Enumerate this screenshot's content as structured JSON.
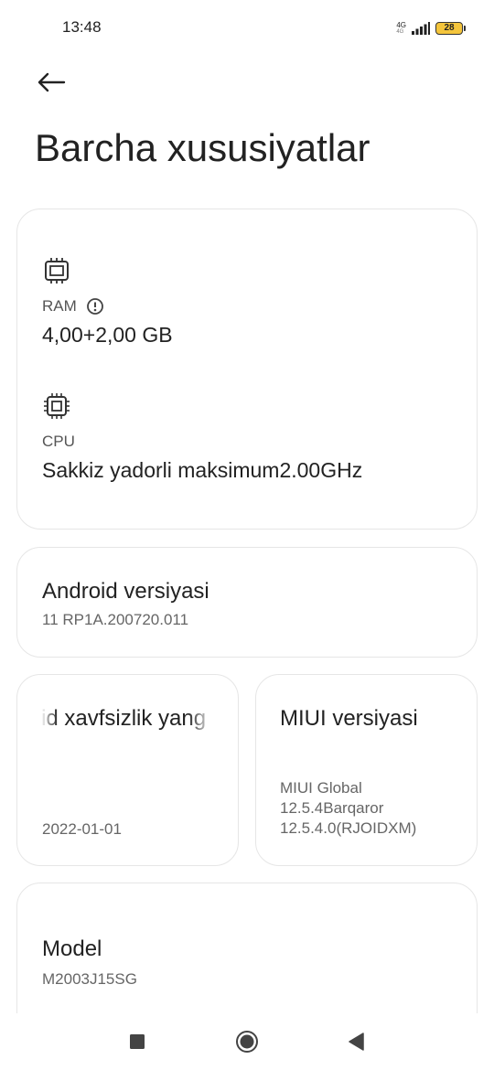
{
  "status_bar": {
    "time": "13:48",
    "network": "4G",
    "network_sub": "4G",
    "battery": "28"
  },
  "header": {
    "back_icon": "arrow-left-icon",
    "title": "Barcha xususiyatlar"
  },
  "specs": {
    "ram": {
      "icon": "chip-icon",
      "label": "RAM",
      "info_icon": "info-icon",
      "value": "4,00+2,00 GB"
    },
    "cpu": {
      "icon": "processor-icon",
      "label": "CPU",
      "value": "Sakkiz yadorli maksimum2.00GHz"
    }
  },
  "android": {
    "title": "Android versiyasi",
    "value": "11 RP1A.200720.011"
  },
  "security": {
    "title": "id xavfsizlik yang",
    "value": "2022-01-01"
  },
  "miui": {
    "title": "MIUI versiyasi",
    "line1": "MIUI Global",
    "line2": "12.5.4Barqaror",
    "line3": "12.5.4.0(RJOIDXM)"
  },
  "model": {
    "title": "Model",
    "value": "M2003J15SG"
  },
  "nav": {
    "recents_icon": "square-icon",
    "home_icon": "circle-icon",
    "back_icon": "triangle-back-icon"
  }
}
